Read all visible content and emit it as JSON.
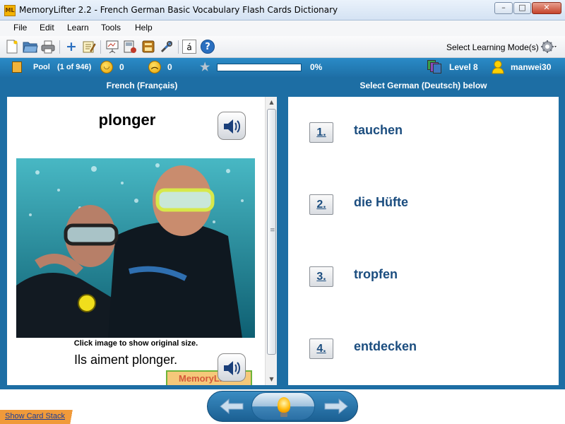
{
  "window": {
    "app_icon_text": "ML",
    "title": "MemoryLifter 2.2 - French German Basic Vocabulary Flash Cards Dictionary",
    "controls": [
      "–",
      "□",
      "✕"
    ]
  },
  "menu": [
    "File",
    "Edit",
    "Learn",
    "Tools",
    "Help"
  ],
  "toolbar": {
    "icons": [
      "new-file-icon",
      "open-folder-icon",
      "print-icon",
      "add-icon",
      "edit-icon",
      "presentation-icon",
      "card-settings-icon",
      "save-card-icon",
      "tools-icon",
      "character-map-icon",
      "help-icon"
    ],
    "character_map_glyph": "á",
    "help_glyph": "?",
    "mode_label": "Select Learning Mode(s)"
  },
  "status": {
    "pool_label": "Pool",
    "pool_count": "(1 of 946)",
    "correct_count": "0",
    "wrong_count": "0",
    "progress_percent": 0,
    "progress_text": "0%",
    "level": "Level 8",
    "user": "manwei30"
  },
  "question": {
    "heading": "French (Français)",
    "word": "plonger",
    "caption": "Click image to show original size.",
    "example": "Ils aiment plonger.",
    "badge": "MemoryLifter"
  },
  "answers": {
    "heading": "Select German (Deutsch) below",
    "options": [
      {
        "num": "1.",
        "text": "tauchen"
      },
      {
        "num": "2.",
        "text": "die Hüfte"
      },
      {
        "num": "3.",
        "text": "tropfen"
      },
      {
        "num": "4.",
        "text": "entdecken"
      }
    ]
  },
  "footer": {
    "show_card_stack": "Show Card Stack"
  },
  "colors": {
    "accent_blue": "#1d6ea4",
    "answer_text": "#1b4d7f",
    "stack_tab": "#f09a3a"
  }
}
